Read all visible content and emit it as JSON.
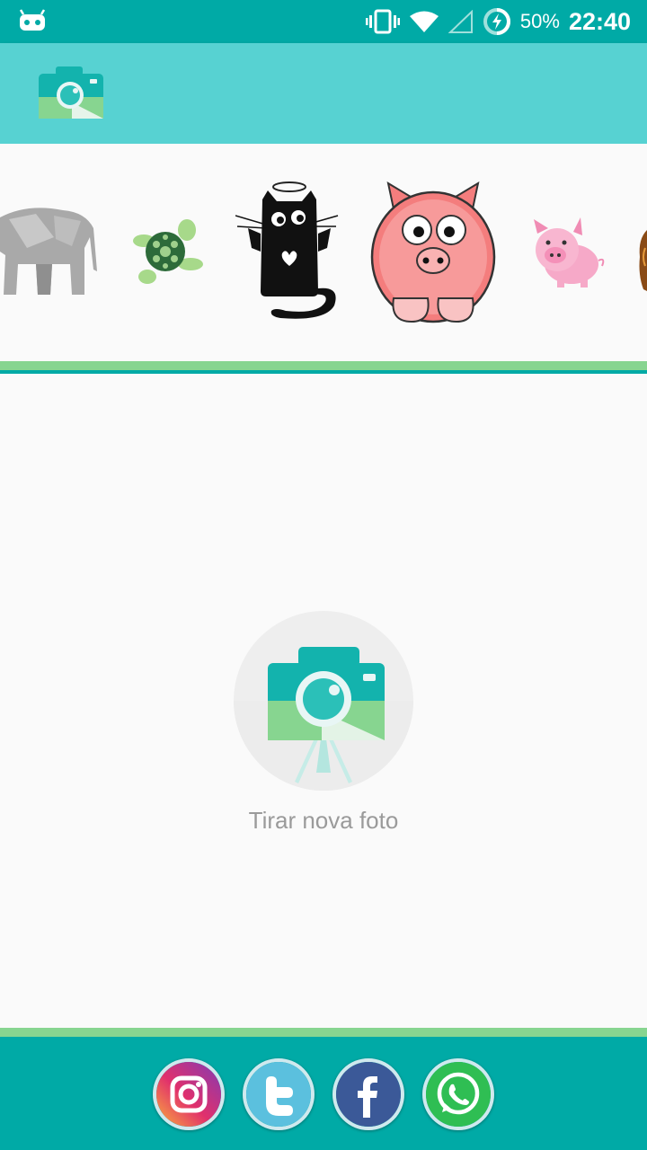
{
  "status_bar": {
    "battery_percent": "50%",
    "time": "22:40",
    "icons": [
      "android-notification-icon",
      "vibrate-icon",
      "wifi-icon",
      "cell-signal-icon",
      "battery-charging-icon"
    ]
  },
  "toolbar": {
    "logo_icon": "camera-gallery-icon"
  },
  "stickers": [
    "elephant",
    "turtle",
    "angel-cat",
    "cartoon-pig",
    "small-pig",
    "bear"
  ],
  "main": {
    "take_photo_label": "Tirar nova foto",
    "take_photo_icon": "camera-tripod-icon"
  },
  "footer": {
    "share": [
      "instagram",
      "twitter",
      "facebook",
      "whatsapp"
    ]
  },
  "colors": {
    "primary_dark": "#00aaa6",
    "primary": "#57d2d2",
    "accent_green": "#87d590"
  }
}
